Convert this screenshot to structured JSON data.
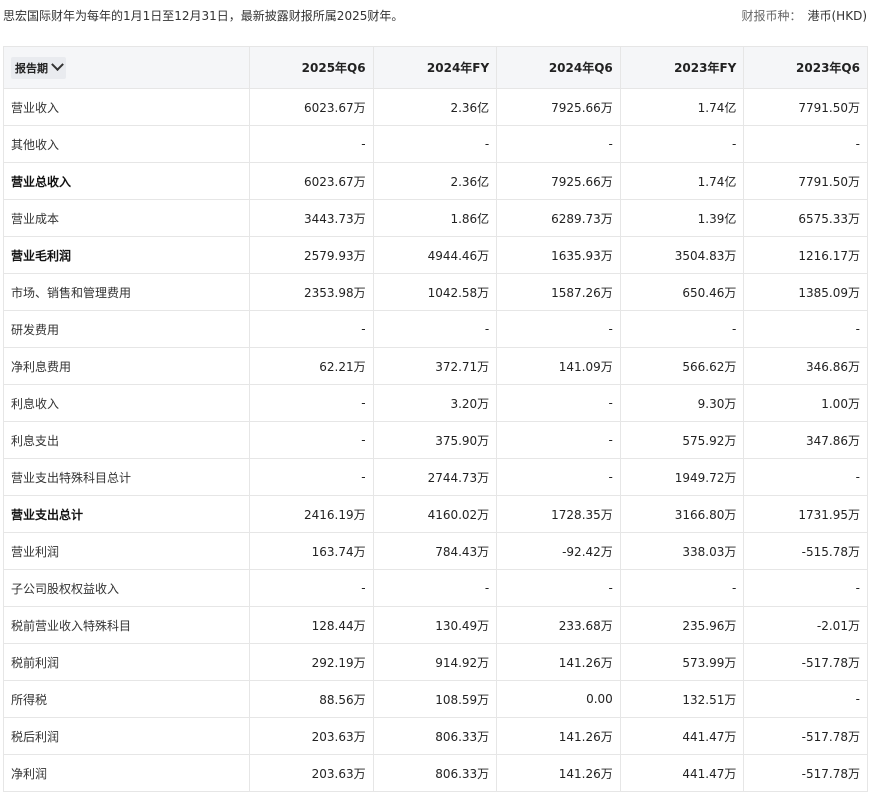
{
  "header": {
    "note": "思宏国际财年为每年的1月1日至12月31日，最新披露财报所属2025财年。",
    "currency_label": "财报币种：",
    "currency_value": "港币(HKD)"
  },
  "table": {
    "period_label": "报告期",
    "columns": [
      "2025年Q6",
      "2024年FY",
      "2024年Q6",
      "2023年FY",
      "2023年Q6"
    ],
    "rows": [
      {
        "name": "营业收入",
        "bold": false,
        "values": [
          "6023.67万",
          "2.36亿",
          "7925.66万",
          "1.74亿",
          "7791.50万"
        ]
      },
      {
        "name": "其他收入",
        "bold": false,
        "values": [
          "-",
          "-",
          "-",
          "-",
          "-"
        ]
      },
      {
        "name": "营业总收入",
        "bold": true,
        "values": [
          "6023.67万",
          "2.36亿",
          "7925.66万",
          "1.74亿",
          "7791.50万"
        ]
      },
      {
        "name": "营业成本",
        "bold": false,
        "values": [
          "3443.73万",
          "1.86亿",
          "6289.73万",
          "1.39亿",
          "6575.33万"
        ]
      },
      {
        "name": "营业毛利润",
        "bold": true,
        "values": [
          "2579.93万",
          "4944.46万",
          "1635.93万",
          "3504.83万",
          "1216.17万"
        ]
      },
      {
        "name": "市场、销售和管理费用",
        "bold": false,
        "values": [
          "2353.98万",
          "1042.58万",
          "1587.26万",
          "650.46万",
          "1385.09万"
        ]
      },
      {
        "name": "研发费用",
        "bold": false,
        "values": [
          "-",
          "-",
          "-",
          "-",
          "-"
        ]
      },
      {
        "name": "净利息费用",
        "bold": false,
        "values": [
          "62.21万",
          "372.71万",
          "141.09万",
          "566.62万",
          "346.86万"
        ]
      },
      {
        "name": "利息收入",
        "bold": false,
        "values": [
          "-",
          "3.20万",
          "-",
          "9.30万",
          "1.00万"
        ]
      },
      {
        "name": "利息支出",
        "bold": false,
        "values": [
          "-",
          "375.90万",
          "-",
          "575.92万",
          "347.86万"
        ]
      },
      {
        "name": "营业支出特殊科目总计",
        "bold": false,
        "values": [
          "-",
          "2744.73万",
          "-",
          "1949.72万",
          "-"
        ]
      },
      {
        "name": "营业支出总计",
        "bold": true,
        "values": [
          "2416.19万",
          "4160.02万",
          "1728.35万",
          "3166.80万",
          "1731.95万"
        ]
      },
      {
        "name": "营业利润",
        "bold": false,
        "values": [
          "163.74万",
          "784.43万",
          "-92.42万",
          "338.03万",
          "-515.78万"
        ]
      },
      {
        "name": "子公司股权权益收入",
        "bold": false,
        "values": [
          "-",
          "-",
          "-",
          "-",
          "-"
        ]
      },
      {
        "name": "税前营业收入特殊科目",
        "bold": false,
        "values": [
          "128.44万",
          "130.49万",
          "233.68万",
          "235.96万",
          "-2.01万"
        ]
      },
      {
        "name": "税前利润",
        "bold": false,
        "values": [
          "292.19万",
          "914.92万",
          "141.26万",
          "573.99万",
          "-517.78万"
        ]
      },
      {
        "name": "所得税",
        "bold": false,
        "values": [
          "88.56万",
          "108.59万",
          "0.00",
          "132.51万",
          "-"
        ]
      },
      {
        "name": "税后利润",
        "bold": false,
        "values": [
          "203.63万",
          "806.33万",
          "141.26万",
          "441.47万",
          "-517.78万"
        ]
      },
      {
        "name": "净利润",
        "bold": false,
        "values": [
          "203.63万",
          "806.33万",
          "141.26万",
          "441.47万",
          "-517.78万"
        ]
      }
    ]
  }
}
